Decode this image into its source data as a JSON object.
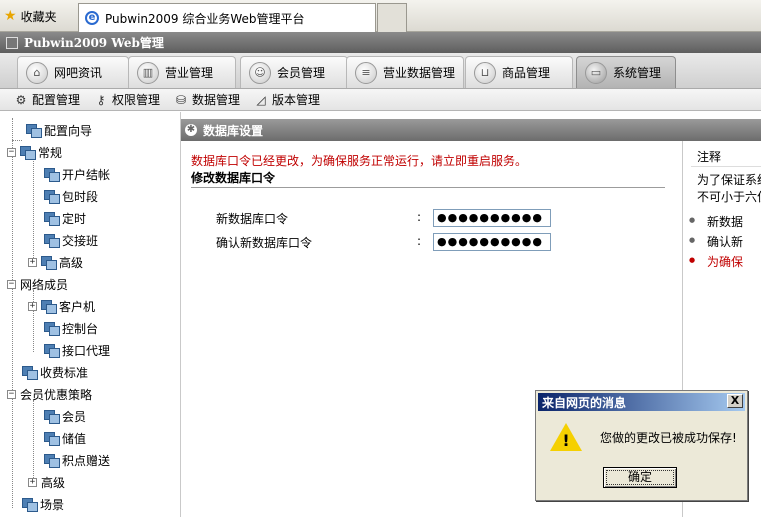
{
  "browser": {
    "favorites_label": "收藏夹",
    "tab_title": "Pubwin2009 综合业务Web管理平台"
  },
  "app": {
    "title": "Pubwin2009 Web管理"
  },
  "main_nav": [
    {
      "label": "网吧资讯",
      "icon": "home-icon"
    },
    {
      "label": "营业管理",
      "icon": "chart-icon"
    },
    {
      "label": "会员管理",
      "icon": "user-icon"
    },
    {
      "label": "营业数据管理",
      "icon": "document-icon"
    },
    {
      "label": "商品管理",
      "icon": "cart-icon"
    },
    {
      "label": "系统管理",
      "icon": "monitor-icon",
      "active": true
    }
  ],
  "sub_nav": [
    {
      "label": "配置管理",
      "icon": "gear-icon"
    },
    {
      "label": "权限管理",
      "icon": "key-icon"
    },
    {
      "label": "数据管理",
      "icon": "database-icon"
    },
    {
      "label": "版本管理",
      "icon": "version-icon"
    }
  ],
  "tree": {
    "config_wizard": "配置向导",
    "general": "常规",
    "open_close": "开户结帐",
    "time_package": "包时段",
    "timing": "定时",
    "shift": "交接班",
    "advanced1": "高级",
    "network_members": "网络成员",
    "client": "客户机",
    "console": "控制台",
    "api_proxy": "接口代理",
    "billing_standard": "收费标准",
    "member_discount": "会员优惠策略",
    "member": "会员",
    "stored_value": "储值",
    "points_gift": "积点赠送",
    "advanced2": "高级",
    "scene": "场景"
  },
  "content": {
    "header": "数据库设置",
    "alert": "数据库口令已经更改，为确保服务正常运行，请立即重启服务。",
    "form_title": "修改数据库口令",
    "new_password_label": "新数据库口令",
    "confirm_password_label": "确认新数据库口令",
    "colon": ":",
    "new_password_value": "●●●●●●●●●●",
    "confirm_password_value": "●●●●●●●●●●"
  },
  "notes": {
    "title": "注释",
    "line1": "为了保证系统",
    "line2": "不可小于六位",
    "bullet1": "新数据",
    "bullet2": "确认新",
    "bullet3": "为确保"
  },
  "dialog": {
    "title": "来自网页的消息",
    "close": "X",
    "message": "您做的更改已被成功保存!",
    "ok": "确定"
  }
}
